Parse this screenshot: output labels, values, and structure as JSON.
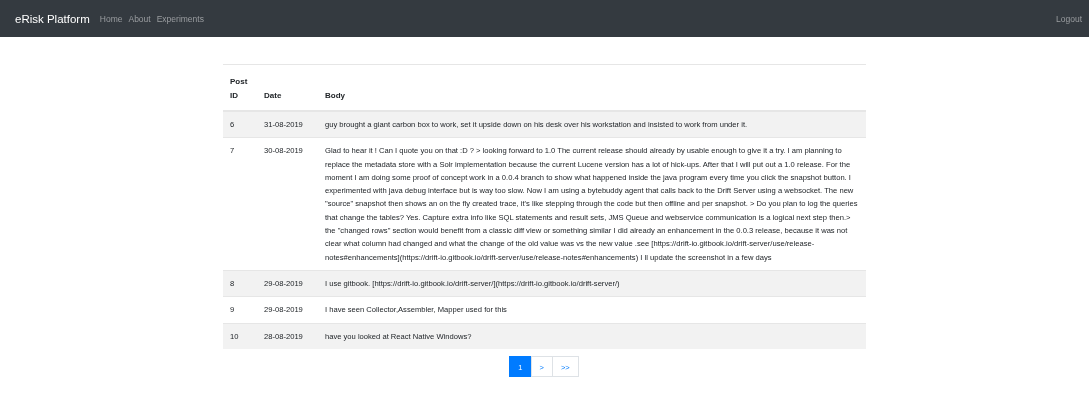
{
  "navbar": {
    "brand": "eRisk Platform",
    "links": [
      {
        "label": "Home"
      },
      {
        "label": "About"
      },
      {
        "label": "Experiments"
      }
    ],
    "logout": "Logout"
  },
  "table": {
    "columns": [
      "Post ID",
      "Date",
      "Body"
    ],
    "rows": [
      {
        "id": "6",
        "date": "31-08-2019",
        "body": "guy brought a giant carbon box to work, set it upside down on his desk over his workstation and insisted to work from under it."
      },
      {
        "id": "7",
        "date": "30-08-2019",
        "body": "Glad to hear it ! Can I quote you on that :D ? > looking forward to 1.0 The current release should already by usable enough to give it a try. I am planning to replace the metadata store with a Solr implementation because the current Lucene version has a lot of hick-ups. After that I will put out a 1.0 release. For the moment I am doing some proof of concept work in a 0.0.4 branch to show what happened inside the java program every time you click the snapshot button. I experimented with java debug interface but is way too slow. Now I am using a bytebuddy agent that calls back to the Drift Server using a websocket. The new \"source\" snapshot then shows an on the fly created trace, it's like stepping through the code but then offline and per snapshot. > Do you plan to log the queries that change the tables? Yes. Capture extra info like SQL statements and result sets, JMS Queue and webservice communication is a logical next step then.> the \"changed rows\" section would benefit from a classic diff view or something similar I did already an enhancement in the 0.0.3 release, because it was not clear what column had changed and what the change of the old value was vs the new value .see [https://drift-io.gitbook.io/drift-server/use/release-notes#enhancements](https://drift-io.gitbook.io/drift-server/use/release-notes#enhancements) I ll update the screenshot in a few days"
      },
      {
        "id": "8",
        "date": "29-08-2019",
        "body": "I use gitbook. [https://drift-io.gitbook.io/drift-server/](https://drift-io.gitbook.io/drift-server/)"
      },
      {
        "id": "9",
        "date": "29-08-2019",
        "body": "I have seen Collector,Assembler, Mapper used for this"
      },
      {
        "id": "10",
        "date": "28-08-2019",
        "body": "have you looked at React Native Windows?"
      }
    ]
  },
  "pagination": [
    {
      "label": "1",
      "selected": true
    },
    {
      "label": ">",
      "selected": false
    },
    {
      "label": ">>",
      "selected": false
    }
  ]
}
